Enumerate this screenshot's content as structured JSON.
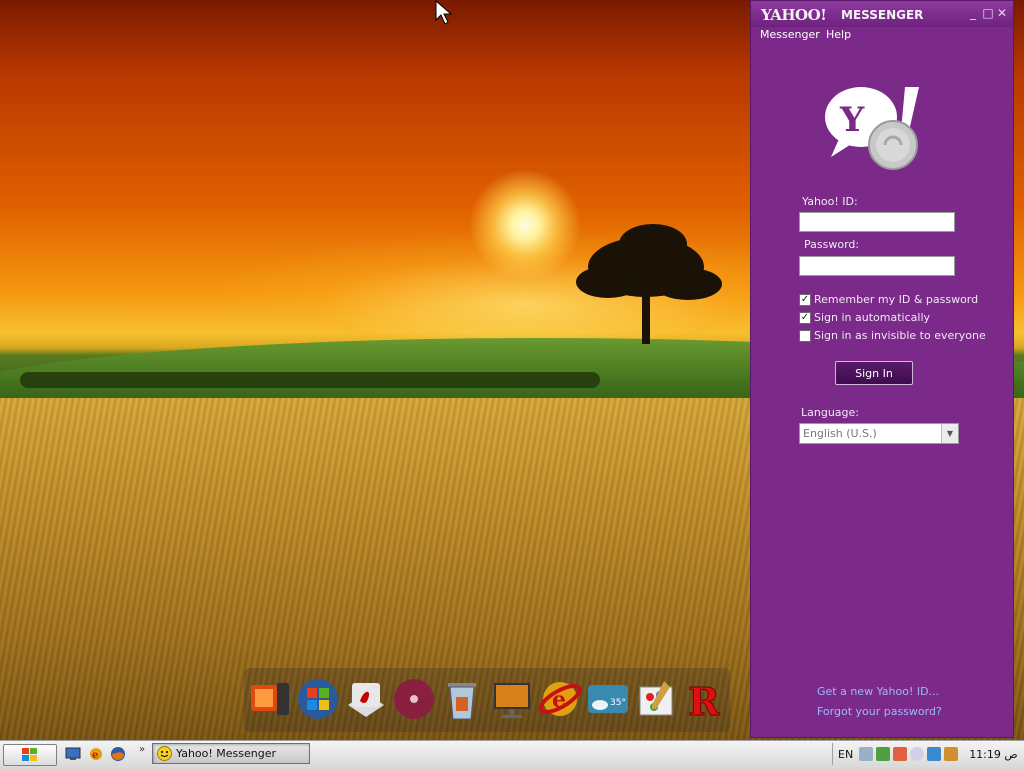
{
  "window": {
    "logo": "YAHOO!",
    "title": "MESSENGER",
    "controls": {
      "minimize": "_",
      "maximize": "□",
      "close": "✕"
    }
  },
  "menu": {
    "items": [
      "Messenger",
      "Help"
    ]
  },
  "login": {
    "id_label": "Yahoo! ID:",
    "id_value": "",
    "password_label": "Password:",
    "password_value": "",
    "remember": {
      "label": "Remember my ID & password",
      "checked": true
    },
    "auto": {
      "label": "Sign in automatically",
      "checked": true
    },
    "invisible": {
      "label": "Sign in as invisible to everyone",
      "checked": false
    },
    "sign_in_button": "Sign In",
    "language_label": "Language:",
    "language_value": "English (U.S.)",
    "link_new_id": "Get a new Yahoo! ID...",
    "link_forgot": "Forgot your password?"
  },
  "dock": {
    "icons": [
      "media-player-icon",
      "windows-logo-icon",
      "adobe-reader-icon",
      "dvd-icon",
      "recycle-bin-icon",
      "photo-viewer-icon",
      "internet-explorer-icon",
      "weather-widget-icon",
      "paint-icon",
      "r-app-icon"
    ],
    "weather_temp": "35°"
  },
  "taskbar": {
    "task_button": "Yahoo! Messenger",
    "language": "EN",
    "clock": "11:19 ص",
    "quick_more": "»"
  },
  "colors": {
    "messenger_purple": "#7b2a8a",
    "link": "#9fb8ff"
  }
}
